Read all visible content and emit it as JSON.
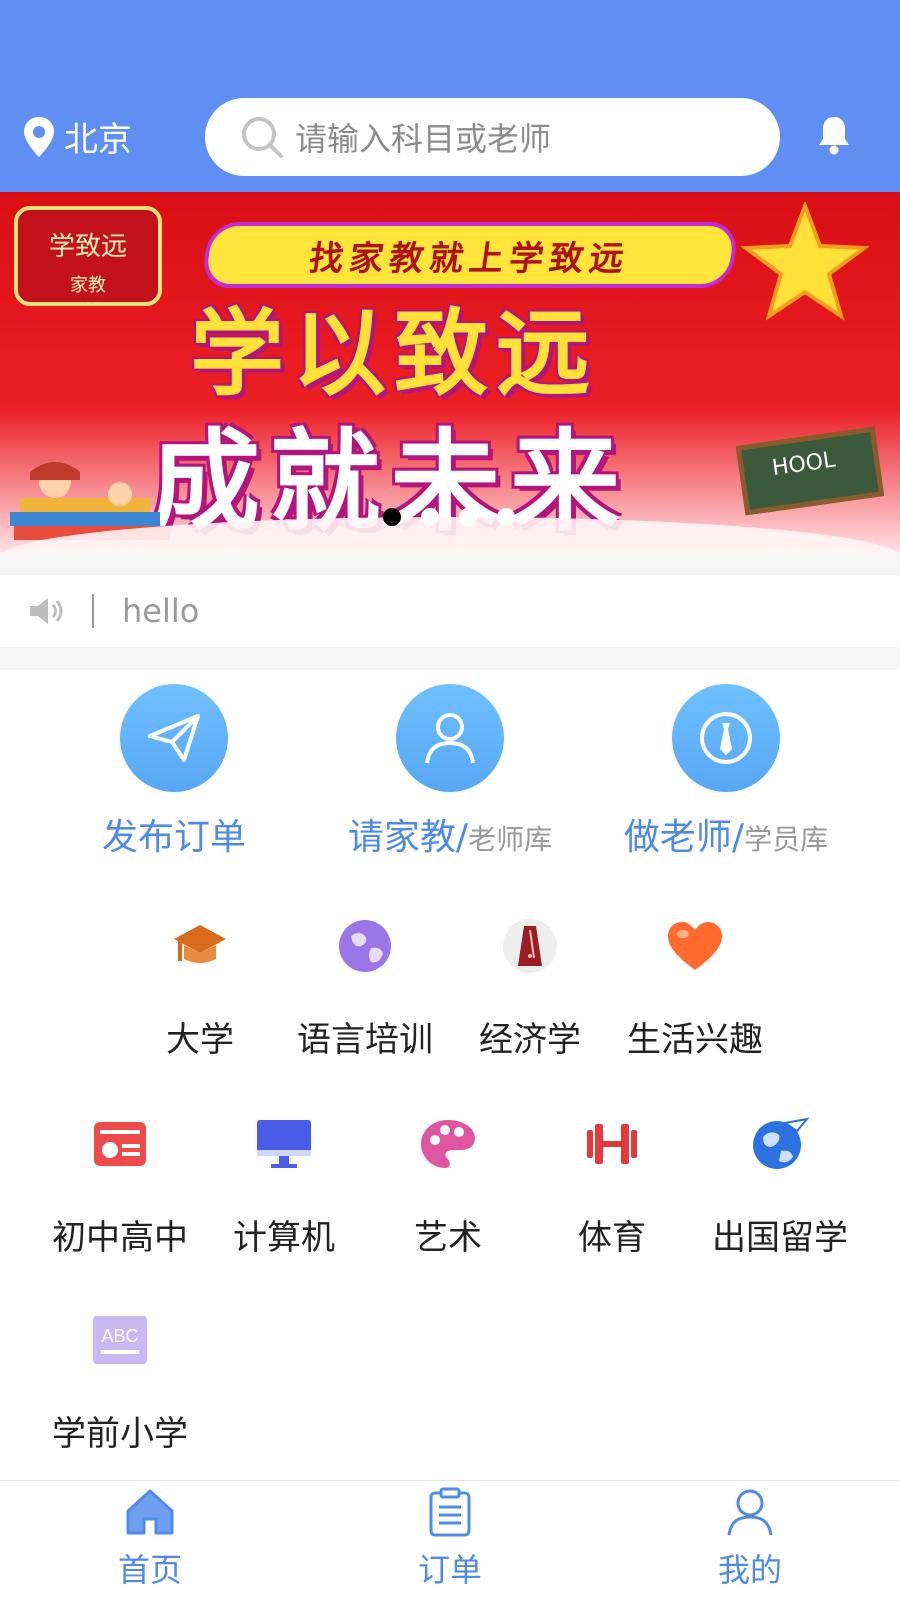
{
  "header": {
    "location": "北京",
    "search_placeholder": "请输入科目或老师",
    "bg_color": "#5f8ff2"
  },
  "banner": {
    "logo_line1": "学致远",
    "logo_line2": "家教",
    "tagline": "找家教就上学致远",
    "headline1": "学以致远",
    "headline2": "成就未来",
    "board_text": "HOOL",
    "slides": 4,
    "active_slide": 1
  },
  "notice": {
    "text": "hello",
    "icon": "speaker-icon"
  },
  "actions": [
    {
      "label": "发布订单",
      "sub": "",
      "icon": "paper-plane-icon"
    },
    {
      "label": "请家教/",
      "sub": "老师库",
      "icon": "teacher-person-icon"
    },
    {
      "label": "做老师/",
      "sub": "学员库",
      "icon": "tie-badge-icon"
    }
  ],
  "categories": [
    {
      "name": "大学",
      "icon": "graduation-cap-icon"
    },
    {
      "name": "语言培训",
      "icon": "globe-icon"
    },
    {
      "name": "经济学",
      "icon": "metronome-icon"
    },
    {
      "name": "生活兴趣",
      "icon": "heart-icon"
    },
    {
      "name": "初中高中",
      "icon": "id-card-icon"
    },
    {
      "name": "计算机",
      "icon": "monitor-icon"
    },
    {
      "name": "艺术",
      "icon": "palette-icon"
    },
    {
      "name": "体育",
      "icon": "dumbbell-icon"
    },
    {
      "name": "出国留学",
      "icon": "earth-plane-icon"
    },
    {
      "name": "学前小学",
      "icon": "abc-icon"
    }
  ],
  "tabbar": [
    {
      "name": "首页",
      "icon": "home-icon"
    },
    {
      "name": "订单",
      "icon": "clipboard-icon"
    },
    {
      "name": "我的",
      "icon": "user-icon"
    }
  ],
  "accent_color": "#4f8be6"
}
